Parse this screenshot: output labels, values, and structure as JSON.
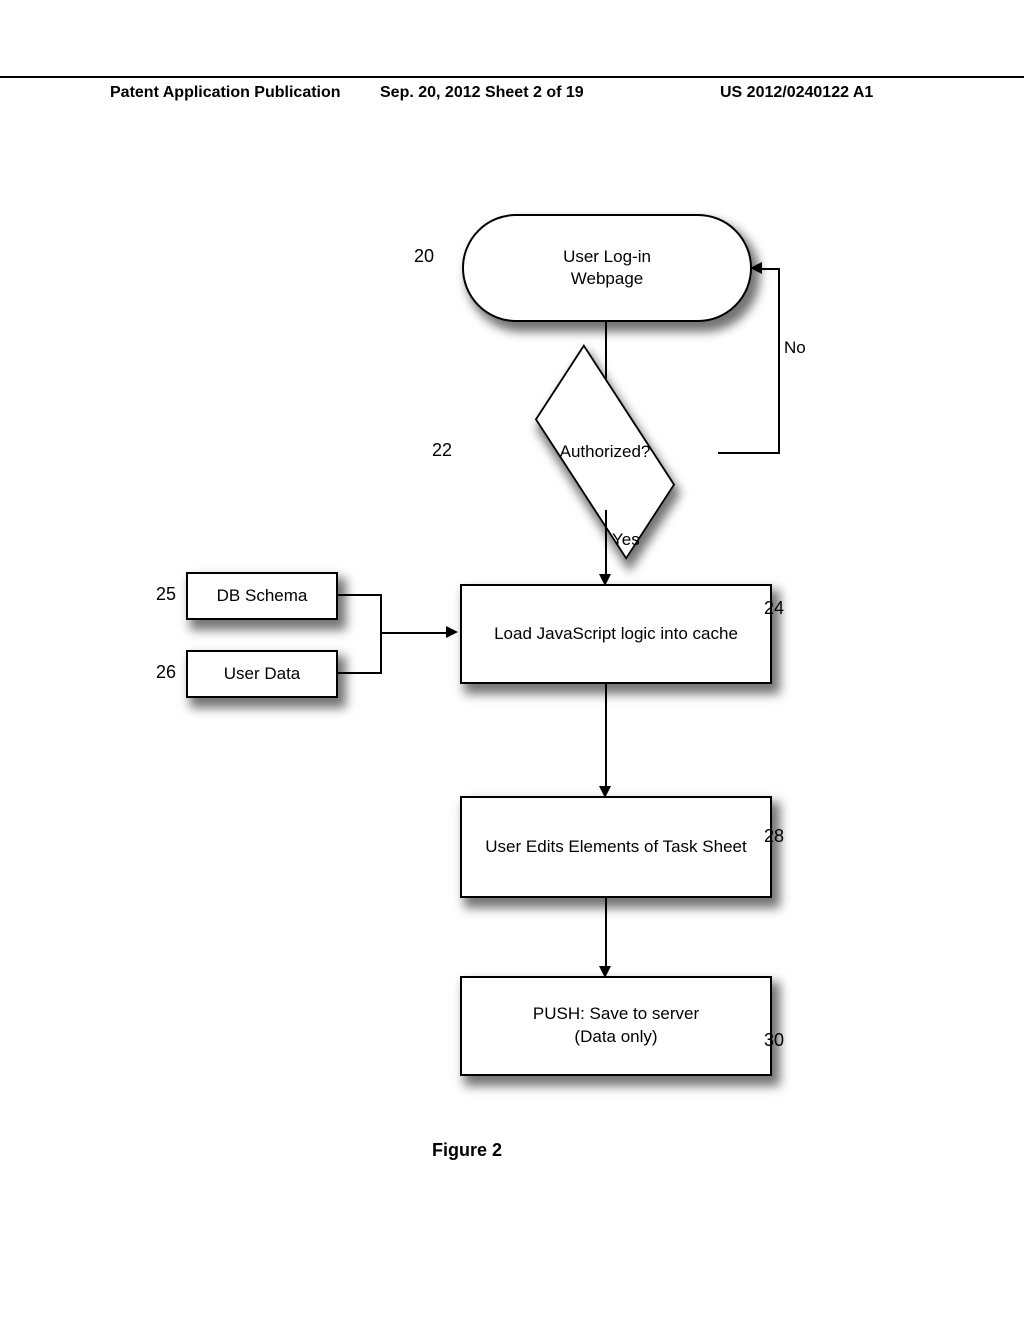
{
  "header": {
    "left": "Patent Application Publication",
    "mid": "Sep. 20, 2012  Sheet 2 of 19",
    "right": "US 2012/0240122 A1"
  },
  "refs": {
    "n20": "20",
    "n22": "22",
    "n24": "24",
    "n25": "25",
    "n26": "26",
    "n28": "28",
    "n30": "30"
  },
  "edges": {
    "no": "No",
    "yes": "Yes"
  },
  "nodes": {
    "login": "User Log-in\nWebpage",
    "authorized": "Authorized?",
    "load": "Load JavaScript logic into cache",
    "dbschema": "DB Schema",
    "userdata": "User Data",
    "edits": "User Edits Elements of Task Sheet",
    "push": "PUSH: Save to server\n(Data only)"
  },
  "caption": "Figure 2"
}
